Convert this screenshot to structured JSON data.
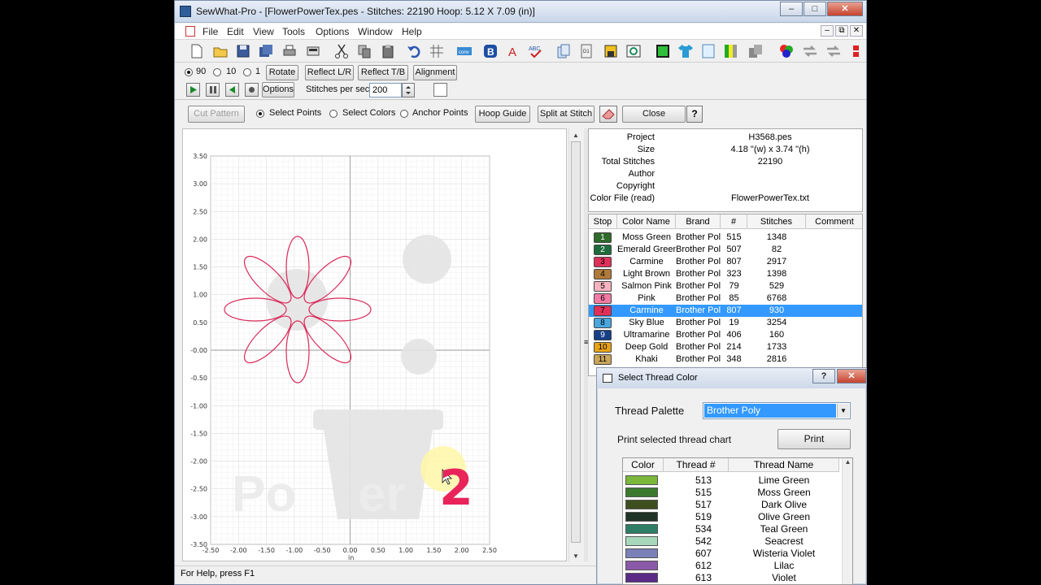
{
  "window": {
    "title": "SewWhat-Pro - [FlowerPowerTex.pes - Stitches: 22190   Hoop: 5.12 X 7.09 (in)]",
    "min_icon": "minimize-icon",
    "max_icon": "maximize-icon",
    "close_icon": "close-icon"
  },
  "menu": [
    "File",
    "Edit",
    "View",
    "Tools",
    "Options",
    "Window",
    "Help"
  ],
  "play_controls": {
    "radio_90": "90",
    "radio_10": "10",
    "radio_1": "1",
    "rotate": "Rotate",
    "reflect_lr": "Reflect L/R",
    "reflect_tb": "Reflect T/B",
    "alignment": "Alignment",
    "options": "Options",
    "stitches_per_sec_label": "Stitches per sec",
    "stitches_per_sec_value": "200"
  },
  "edit_bar": {
    "cut_pattern": "Cut Pattern",
    "select_points": "Select Points",
    "select_colors": "Select Colors",
    "anchor_points": "Anchor Points",
    "hoop_guide": "Hoop Guide",
    "split_at_stitch": "Split at Stitch",
    "close": "Close",
    "help_glyph": "?"
  },
  "canvas": {
    "y_ticks": [
      "3.50",
      "3.00",
      "2.50",
      "2.00",
      "1.50",
      "1.00",
      "0.50",
      "-0.00",
      "-0.50",
      "-1.00",
      "-1.50",
      "-2.00",
      "-2.50",
      "-3.00",
      "-3.50"
    ],
    "x_ticks": [
      "-2.50",
      "-2.00",
      "-1.50",
      "-1.00",
      "-0.50",
      "0.00",
      "0.50",
      "1.00",
      "1.50",
      "2.00",
      "2.50"
    ],
    "unit": "in",
    "annotation": "2"
  },
  "info": {
    "rows": [
      {
        "key": "Project",
        "value": "H3568.pes"
      },
      {
        "key": "Size",
        "value": "4.18 \"(w) x 3.74 \"(h)"
      },
      {
        "key": "Total Stitches",
        "value": "22190"
      },
      {
        "key": "Author",
        "value": ""
      },
      {
        "key": "Copyright",
        "value": ""
      },
      {
        "key": "Color File (read)",
        "value": "FlowerPowerTex.txt"
      }
    ]
  },
  "color_list": {
    "headers": [
      "Stop",
      "Color Name",
      "Brand",
      "#",
      "Stitches",
      "Comment"
    ],
    "rows": [
      {
        "stop": "1",
        "name": "Moss Green",
        "brand": "Brother Poly",
        "num": "515",
        "stitches": "1348",
        "color": "#2f6b2a"
      },
      {
        "stop": "2",
        "name": "Emerald Green",
        "brand": "Brother Poly",
        "num": "507",
        "stitches": "82",
        "color": "#1f6b3c"
      },
      {
        "stop": "3",
        "name": "Carmine",
        "brand": "Brother Poly",
        "num": "807",
        "stitches": "2917",
        "color": "#e0305a"
      },
      {
        "stop": "4",
        "name": "Light Brown",
        "brand": "Brother Poly",
        "num": "323",
        "stitches": "1398",
        "color": "#b07a3a"
      },
      {
        "stop": "5",
        "name": "Salmon Pink",
        "brand": "Brother Poly",
        "num": "79",
        "stitches": "529",
        "color": "#f7b3c0"
      },
      {
        "stop": "6",
        "name": "Pink",
        "brand": "Brother Poly",
        "num": "85",
        "stitches": "6768",
        "color": "#f27aa5"
      },
      {
        "stop": "7",
        "name": "Carmine",
        "brand": "Brother Poly",
        "num": "807",
        "stitches": "930",
        "color": "#e0305a",
        "selected": true
      },
      {
        "stop": "8",
        "name": "Sky Blue",
        "brand": "Brother Poly",
        "num": "19",
        "stitches": "3254",
        "color": "#4aa6df"
      },
      {
        "stop": "9",
        "name": "Ultramarine",
        "brand": "Brother Poly",
        "num": "406",
        "stitches": "160",
        "color": "#173f86"
      },
      {
        "stop": "10",
        "name": "Deep Gold",
        "brand": "Brother Poly",
        "num": "214",
        "stitches": "1733",
        "color": "#e8a316"
      },
      {
        "stop": "11",
        "name": "Khaki",
        "brand": "Brother Poly",
        "num": "348",
        "stitches": "2816",
        "color": "#c9a55a"
      }
    ]
  },
  "thread_dialog": {
    "title": "Select Thread Color",
    "palette_label": "Thread Palette",
    "palette_value": "Brother Poly",
    "print_label": "Print selected thread chart",
    "print_button": "Print",
    "help_glyph": "?",
    "headers": [
      "Color",
      "Thread #",
      "Thread Name"
    ],
    "rows": [
      {
        "num": "513",
        "name": "Lime Green",
        "color": "#7ab73a"
      },
      {
        "num": "515",
        "name": "Moss Green",
        "color": "#3b7a2e"
      },
      {
        "num": "517",
        "name": "Dark Olive",
        "color": "#3d4f1f"
      },
      {
        "num": "519",
        "name": "Olive Green",
        "color": "#1f3326"
      },
      {
        "num": "534",
        "name": "Teal Green",
        "color": "#2e7d66"
      },
      {
        "num": "542",
        "name": "Seacrest",
        "color": "#a8d8bc"
      },
      {
        "num": "607",
        "name": "Wisteria Violet",
        "color": "#7b80b8"
      },
      {
        "num": "612",
        "name": "Lilac",
        "color": "#8a5aa8"
      },
      {
        "num": "613",
        "name": "Violet",
        "color": "#5b2a86"
      }
    ]
  },
  "status": "For Help, press F1"
}
